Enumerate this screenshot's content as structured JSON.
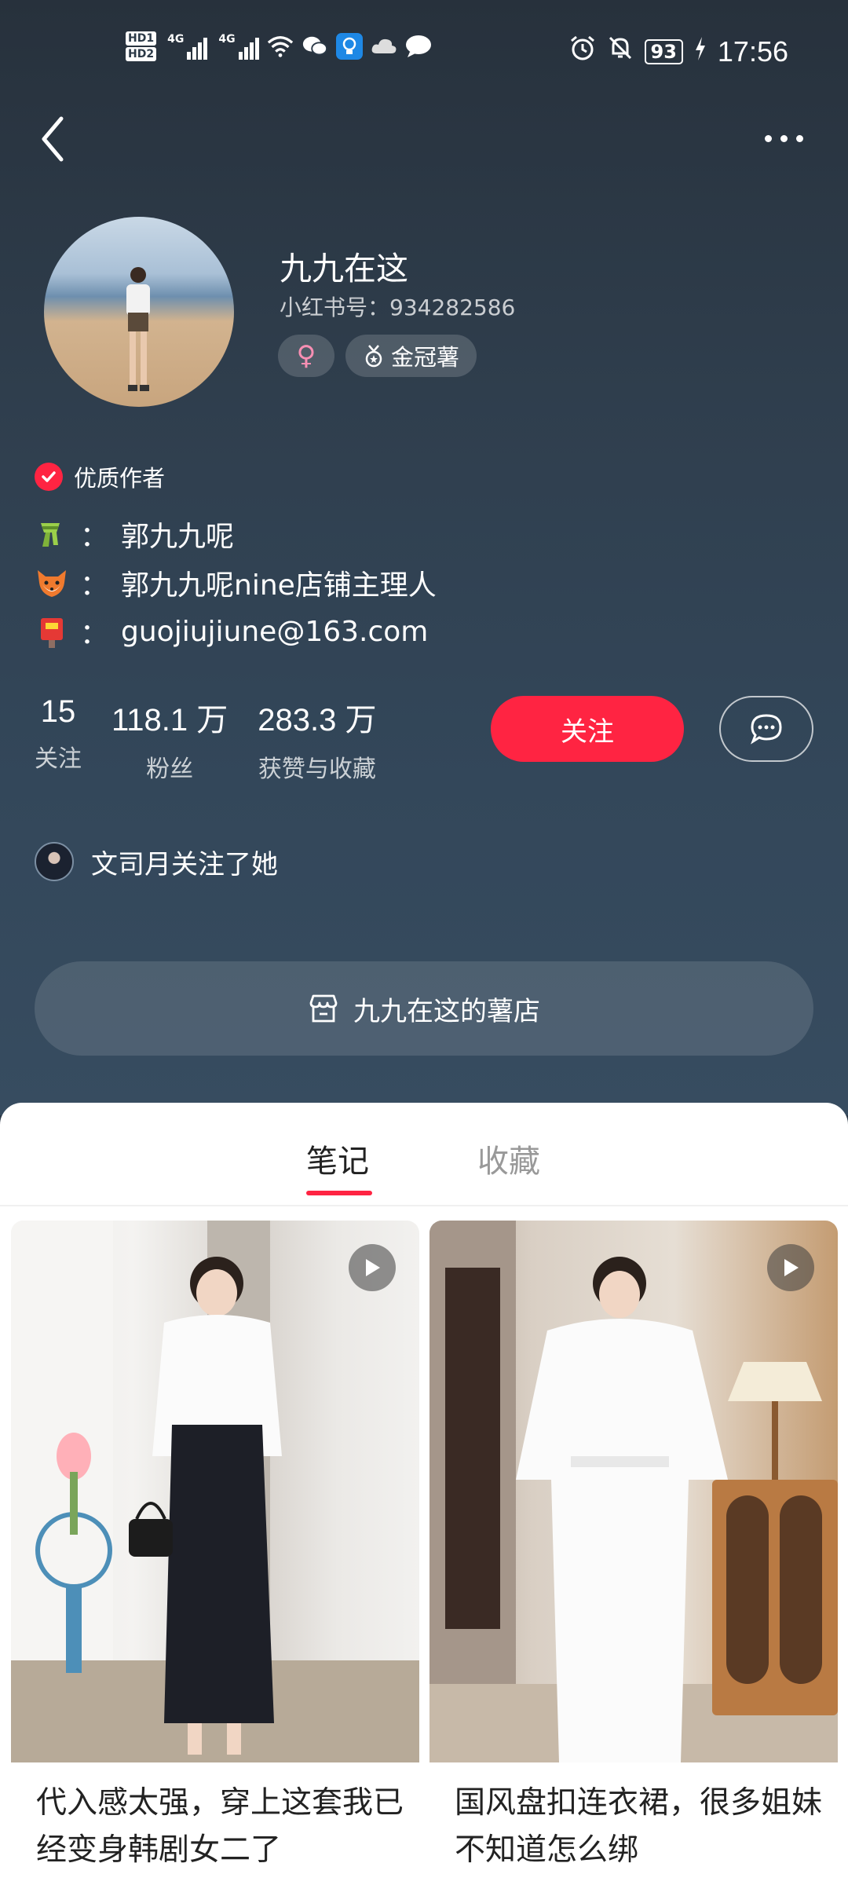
{
  "status_bar": {
    "hd1": "HD1",
    "hd2": "HD2",
    "net1": "4G",
    "net2": "4G",
    "battery": "93",
    "time": "17:56"
  },
  "profile": {
    "name": "九九在这",
    "id_line": "小红书号：934282586",
    "gender_symbol": "♀",
    "badge_label": "金冠薯",
    "quality_label": "优质作者",
    "bio": [
      {
        "icon": "scarf-icon",
        "sep": "：",
        "text": "郭九九呢"
      },
      {
        "icon": "fox-icon",
        "sep": "：",
        "text": "郭九九呢nine店铺主理人"
      },
      {
        "icon": "postbox-icon",
        "sep": "：",
        "text": "guojiujiune@163.com"
      }
    ]
  },
  "stats": [
    {
      "value": "15",
      "label": "关注"
    },
    {
      "value": "118.1 万",
      "label": "粉丝"
    },
    {
      "value": "283.3 万",
      "label": "获赞与收藏"
    }
  ],
  "actions": {
    "follow_label": "关注"
  },
  "followed_by": "文司月关注了她",
  "shop_label": "九九在这的薯店",
  "tabs": [
    {
      "label": "笔记",
      "active": true
    },
    {
      "label": "收藏",
      "active": false
    }
  ],
  "notes": [
    {
      "title": "代入感太强，穿上这套我已经变身韩剧女二了",
      "video": true
    },
    {
      "title": "国风盘扣连衣裙，很多姐妹不知道怎么绑",
      "video": true
    }
  ],
  "colors": {
    "accent": "#ff2442",
    "header_bg": "#2f3e4d"
  }
}
